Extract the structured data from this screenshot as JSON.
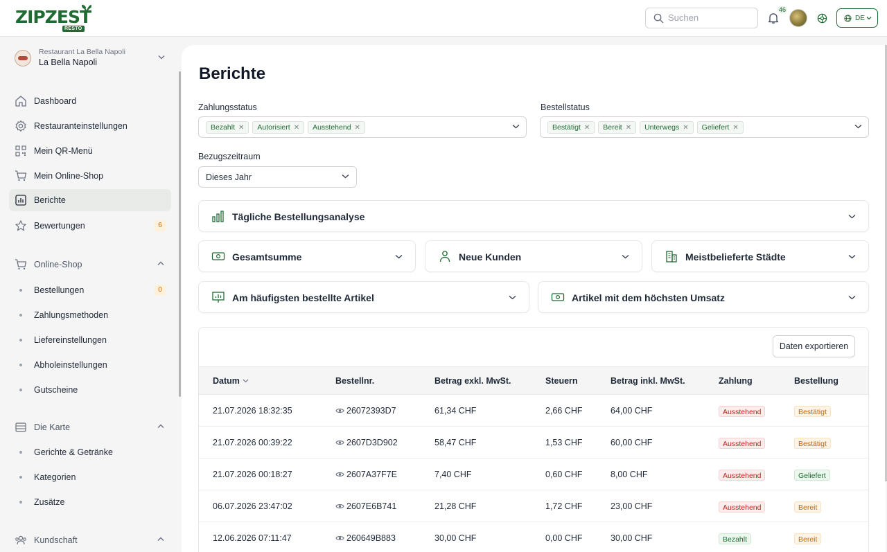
{
  "brand": {
    "logo_text": "ZIPZEST",
    "logo_sub": "RESTO",
    "accent": "#1f6b33"
  },
  "header": {
    "search_placeholder": "Suchen",
    "notification_count": "46",
    "language": "DE"
  },
  "restaurant": {
    "subtitle": "Restaurant La Bella Napoli",
    "name": "La Bella Napoli"
  },
  "sidebar": {
    "items": [
      {
        "label": "Dashboard",
        "icon": "home-icon"
      },
      {
        "label": "Restauranteinstellungen",
        "icon": "gear-icon"
      },
      {
        "label": "Mein QR-Menü",
        "icon": "qr-icon"
      },
      {
        "label": "Mein Online-Shop",
        "icon": "cart-icon"
      },
      {
        "label": "Berichte",
        "icon": "report-icon",
        "active": true
      },
      {
        "label": "Bewertungen",
        "icon": "star-icon",
        "badge": "6"
      }
    ],
    "online_shop": {
      "label": "Online-Shop",
      "children": [
        {
          "label": "Bestellungen",
          "badge": "0"
        },
        {
          "label": "Zahlungsmethoden"
        },
        {
          "label": "Liefereinstellungen"
        },
        {
          "label": "Abholeinstellungen"
        },
        {
          "label": "Gutscheine"
        }
      ]
    },
    "menu": {
      "label": "Die Karte",
      "children": [
        {
          "label": "Gerichte & Getränke"
        },
        {
          "label": "Kategorien"
        },
        {
          "label": "Zusätze"
        }
      ]
    },
    "customers": {
      "label": "Kundschaft"
    }
  },
  "page": {
    "title": "Berichte",
    "payment_status": {
      "label": "Zahlungsstatus",
      "tags": [
        "Bezahlt",
        "Autorisiert",
        "Ausstehend"
      ]
    },
    "order_status": {
      "label": "Bestellstatus",
      "tags": [
        "Bestätigt",
        "Bereit",
        "Unterwegs",
        "Geliefert"
      ]
    },
    "period": {
      "label": "Bezugszeitraum",
      "value": "Dieses Jahr"
    },
    "cards": {
      "daily": "Tägliche Bestellungsanalyse",
      "total": "Gesamtsumme",
      "new_customers": "Neue Kunden",
      "cities": "Meistbelieferte Städte",
      "top_items": "Am häufigsten bestellte Artikel",
      "top_revenue": "Artikel mit dem höchsten Umsatz"
    },
    "export_label": "Daten exportieren"
  },
  "table": {
    "headers": {
      "date": "Datum",
      "order_no": "Bestellnr.",
      "net": "Betrag exkl. MwSt.",
      "tax": "Steuern",
      "gross": "Betrag inkl. MwSt.",
      "payment": "Zahlung",
      "order": "Bestellung"
    },
    "rows": [
      {
        "date": "21.07.2026 18:32:35",
        "order_no": "26072393D7",
        "net": "61,34 CHF",
        "tax": "2,66 CHF",
        "gross": "64,00 CHF",
        "payment": "Ausstehend",
        "order": "Bestätigt"
      },
      {
        "date": "21.07.2026 00:39:22",
        "order_no": "2607D3D902",
        "net": "58,47 CHF",
        "tax": "1,53 CHF",
        "gross": "60,00 CHF",
        "payment": "Ausstehend",
        "order": "Bestätigt"
      },
      {
        "date": "21.07.2026 00:18:27",
        "order_no": "2607A37F7E",
        "net": "7,40 CHF",
        "tax": "0,60 CHF",
        "gross": "8,00 CHF",
        "payment": "Ausstehend",
        "order": "Geliefert"
      },
      {
        "date": "06.07.2026 23:47:02",
        "order_no": "2607E6B741",
        "net": "21,28 CHF",
        "tax": "1,72 CHF",
        "gross": "23,00 CHF",
        "payment": "Ausstehend",
        "order": "Bereit"
      },
      {
        "date": "12.06.2026 07:11:47",
        "order_no": "260649B883",
        "net": "30,00 CHF",
        "tax": "0,00 CHF",
        "gross": "30,00 CHF",
        "payment": "Bezahlt",
        "order": "Bereit"
      }
    ]
  }
}
